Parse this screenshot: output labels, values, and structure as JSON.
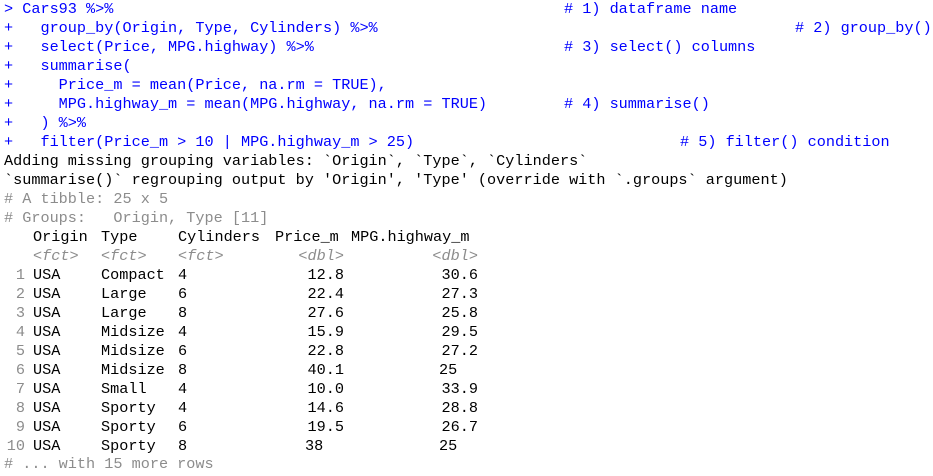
{
  "code_lines": [
    {
      "code": "> Cars93 %>%",
      "comment": "# 1) dataframe name"
    },
    {
      "code": "+   group_by(Origin, Type, Cylinders) %>%",
      "comment": "# 2) group_by()"
    },
    {
      "code": "+   select(Price, MPG.highway) %>%",
      "comment": "# 3) select() columns"
    },
    {
      "code": "+   summarise(",
      "comment": ""
    },
    {
      "code": "+     Price_m = mean(Price, na.rm = TRUE),",
      "comment": ""
    },
    {
      "code": "+     MPG.highway_m = mean(MPG.highway, na.rm = TRUE)",
      "comment": "# 4) summarise()"
    },
    {
      "code": "+   ) %>%",
      "comment": ""
    },
    {
      "code": "+   filter(Price_m > 10 | MPG.highway_m > 25)",
      "comment": "# 5) filter() condition"
    }
  ],
  "messages": [
    "Adding missing grouping variables: `Origin`, `Type`, `Cylinders`",
    "`summarise()` regrouping output by 'Origin', 'Type' (override with `.groups` argument)"
  ],
  "tibble_header": "# A tibble: 25 x 5",
  "groups_header": "# Groups:   Origin, Type [11]",
  "columns": [
    "Origin",
    "Type",
    "Cylinders",
    "Price_m",
    "MPG.highway_m"
  ],
  "types": [
    "<fct>",
    "<fct>",
    "<fct>",
    "<dbl>",
    "<dbl>"
  ],
  "rows": [
    [
      "1",
      "USA",
      "Compact",
      "4",
      "12.8",
      "30.6"
    ],
    [
      "2",
      "USA",
      "Large",
      "6",
      "22.4",
      "27.3"
    ],
    [
      "3",
      "USA",
      "Large",
      "8",
      "27.6",
      "25.8"
    ],
    [
      "4",
      "USA",
      "Midsize",
      "4",
      "15.9",
      "29.5"
    ],
    [
      "5",
      "USA",
      "Midsize",
      "6",
      "22.8",
      "27.2"
    ],
    [
      "6",
      "USA",
      "Midsize",
      "8",
      "40.1",
      "25"
    ],
    [
      "7",
      "USA",
      "Small",
      "4",
      "10.0",
      "33.9"
    ],
    [
      "8",
      "USA",
      "Sporty",
      "4",
      "14.6",
      "28.8"
    ],
    [
      "9",
      "USA",
      "Sporty",
      "6",
      "19.5",
      "26.7"
    ],
    [
      "10",
      "USA",
      "Sporty",
      "8",
      "38",
      "25"
    ]
  ],
  "more_rows": "# ... with 15 more rows"
}
